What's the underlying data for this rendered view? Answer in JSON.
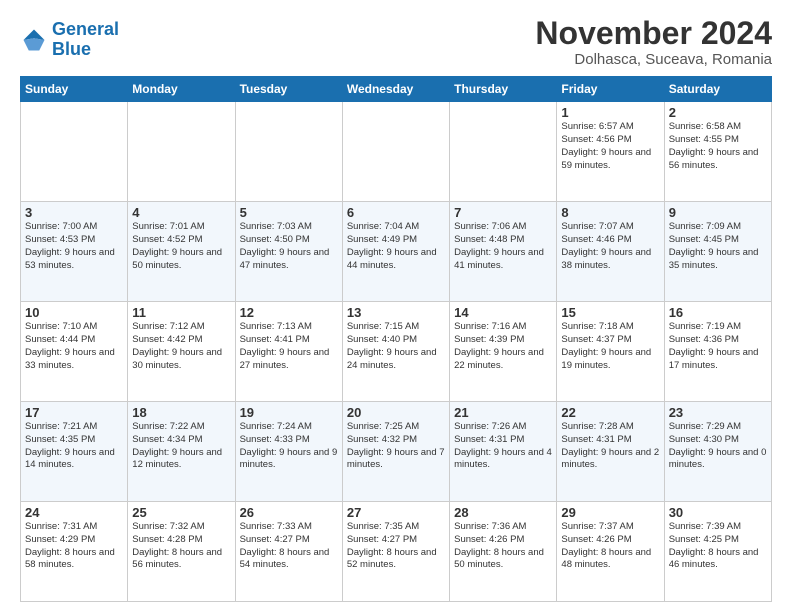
{
  "logo": {
    "line1": "General",
    "line2": "Blue"
  },
  "title": "November 2024",
  "location": "Dolhasca, Suceava, Romania",
  "weekdays": [
    "Sunday",
    "Monday",
    "Tuesday",
    "Wednesday",
    "Thursday",
    "Friday",
    "Saturday"
  ],
  "weeks": [
    [
      {
        "day": "",
        "info": ""
      },
      {
        "day": "",
        "info": ""
      },
      {
        "day": "",
        "info": ""
      },
      {
        "day": "",
        "info": ""
      },
      {
        "day": "",
        "info": ""
      },
      {
        "day": "1",
        "info": "Sunrise: 6:57 AM\nSunset: 4:56 PM\nDaylight: 9 hours and 59 minutes."
      },
      {
        "day": "2",
        "info": "Sunrise: 6:58 AM\nSunset: 4:55 PM\nDaylight: 9 hours and 56 minutes."
      }
    ],
    [
      {
        "day": "3",
        "info": "Sunrise: 7:00 AM\nSunset: 4:53 PM\nDaylight: 9 hours and 53 minutes."
      },
      {
        "day": "4",
        "info": "Sunrise: 7:01 AM\nSunset: 4:52 PM\nDaylight: 9 hours and 50 minutes."
      },
      {
        "day": "5",
        "info": "Sunrise: 7:03 AM\nSunset: 4:50 PM\nDaylight: 9 hours and 47 minutes."
      },
      {
        "day": "6",
        "info": "Sunrise: 7:04 AM\nSunset: 4:49 PM\nDaylight: 9 hours and 44 minutes."
      },
      {
        "day": "7",
        "info": "Sunrise: 7:06 AM\nSunset: 4:48 PM\nDaylight: 9 hours and 41 minutes."
      },
      {
        "day": "8",
        "info": "Sunrise: 7:07 AM\nSunset: 4:46 PM\nDaylight: 9 hours and 38 minutes."
      },
      {
        "day": "9",
        "info": "Sunrise: 7:09 AM\nSunset: 4:45 PM\nDaylight: 9 hours and 35 minutes."
      }
    ],
    [
      {
        "day": "10",
        "info": "Sunrise: 7:10 AM\nSunset: 4:44 PM\nDaylight: 9 hours and 33 minutes."
      },
      {
        "day": "11",
        "info": "Sunrise: 7:12 AM\nSunset: 4:42 PM\nDaylight: 9 hours and 30 minutes."
      },
      {
        "day": "12",
        "info": "Sunrise: 7:13 AM\nSunset: 4:41 PM\nDaylight: 9 hours and 27 minutes."
      },
      {
        "day": "13",
        "info": "Sunrise: 7:15 AM\nSunset: 4:40 PM\nDaylight: 9 hours and 24 minutes."
      },
      {
        "day": "14",
        "info": "Sunrise: 7:16 AM\nSunset: 4:39 PM\nDaylight: 9 hours and 22 minutes."
      },
      {
        "day": "15",
        "info": "Sunrise: 7:18 AM\nSunset: 4:37 PM\nDaylight: 9 hours and 19 minutes."
      },
      {
        "day": "16",
        "info": "Sunrise: 7:19 AM\nSunset: 4:36 PM\nDaylight: 9 hours and 17 minutes."
      }
    ],
    [
      {
        "day": "17",
        "info": "Sunrise: 7:21 AM\nSunset: 4:35 PM\nDaylight: 9 hours and 14 minutes."
      },
      {
        "day": "18",
        "info": "Sunrise: 7:22 AM\nSunset: 4:34 PM\nDaylight: 9 hours and 12 minutes."
      },
      {
        "day": "19",
        "info": "Sunrise: 7:24 AM\nSunset: 4:33 PM\nDaylight: 9 hours and 9 minutes."
      },
      {
        "day": "20",
        "info": "Sunrise: 7:25 AM\nSunset: 4:32 PM\nDaylight: 9 hours and 7 minutes."
      },
      {
        "day": "21",
        "info": "Sunrise: 7:26 AM\nSunset: 4:31 PM\nDaylight: 9 hours and 4 minutes."
      },
      {
        "day": "22",
        "info": "Sunrise: 7:28 AM\nSunset: 4:31 PM\nDaylight: 9 hours and 2 minutes."
      },
      {
        "day": "23",
        "info": "Sunrise: 7:29 AM\nSunset: 4:30 PM\nDaylight: 9 hours and 0 minutes."
      }
    ],
    [
      {
        "day": "24",
        "info": "Sunrise: 7:31 AM\nSunset: 4:29 PM\nDaylight: 8 hours and 58 minutes."
      },
      {
        "day": "25",
        "info": "Sunrise: 7:32 AM\nSunset: 4:28 PM\nDaylight: 8 hours and 56 minutes."
      },
      {
        "day": "26",
        "info": "Sunrise: 7:33 AM\nSunset: 4:27 PM\nDaylight: 8 hours and 54 minutes."
      },
      {
        "day": "27",
        "info": "Sunrise: 7:35 AM\nSunset: 4:27 PM\nDaylight: 8 hours and 52 minutes."
      },
      {
        "day": "28",
        "info": "Sunrise: 7:36 AM\nSunset: 4:26 PM\nDaylight: 8 hours and 50 minutes."
      },
      {
        "day": "29",
        "info": "Sunrise: 7:37 AM\nSunset: 4:26 PM\nDaylight: 8 hours and 48 minutes."
      },
      {
        "day": "30",
        "info": "Sunrise: 7:39 AM\nSunset: 4:25 PM\nDaylight: 8 hours and 46 minutes."
      }
    ]
  ]
}
